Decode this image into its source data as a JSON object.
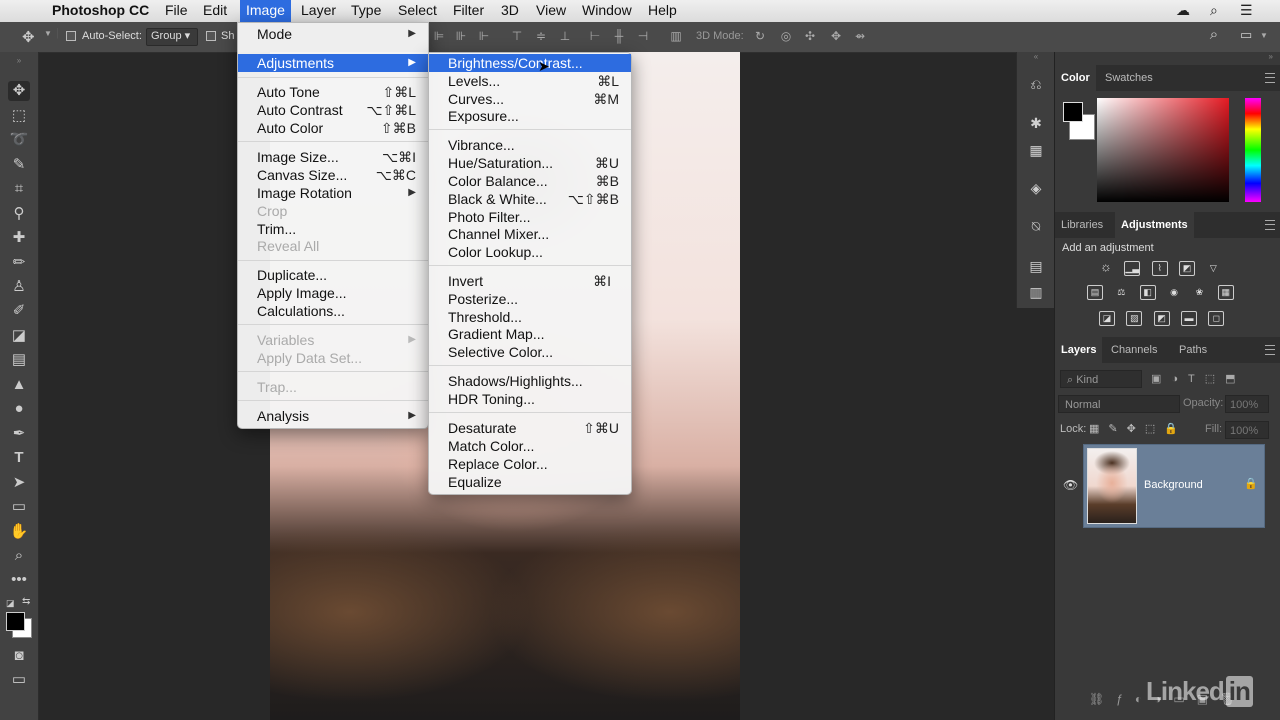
{
  "menubar": {
    "app": "Photoshop CC",
    "items": [
      "File",
      "Edit",
      "Image",
      "Layer",
      "Type",
      "Select",
      "Filter",
      "3D",
      "View",
      "Window",
      "Help"
    ],
    "active": "Image"
  },
  "options_bar": {
    "auto_select_label": "Auto-Select:",
    "auto_select_value": "Group",
    "show_label_partial": "Sh",
    "mode_3d_label": "3D Mode:"
  },
  "image_menu": {
    "items": [
      {
        "label": "Mode",
        "shortcut": "",
        "submenu": true,
        "disabled": false
      },
      {
        "label": "Adjustments",
        "shortcut": "",
        "submenu": true,
        "disabled": false,
        "highlighted": true
      },
      {
        "label": "Auto Tone",
        "shortcut": "⇧⌘L"
      },
      {
        "label": "Auto Contrast",
        "shortcut": "⌥⇧⌘L"
      },
      {
        "label": "Auto Color",
        "shortcut": "⇧⌘B"
      },
      {
        "label": "Image Size...",
        "shortcut": "⌥⌘I"
      },
      {
        "label": "Canvas Size...",
        "shortcut": "⌥⌘C"
      },
      {
        "label": "Image Rotation",
        "submenu": true
      },
      {
        "label": "Crop",
        "disabled": true
      },
      {
        "label": "Trim..."
      },
      {
        "label": "Reveal All",
        "disabled": true
      },
      {
        "label": "Duplicate..."
      },
      {
        "label": "Apply Image..."
      },
      {
        "label": "Calculations..."
      },
      {
        "label": "Variables",
        "submenu": true,
        "disabled": true
      },
      {
        "label": "Apply Data Set...",
        "disabled": true
      },
      {
        "label": "Trap...",
        "disabled": true
      },
      {
        "label": "Analysis",
        "submenu": true
      }
    ]
  },
  "adjustments_menu": {
    "items": [
      {
        "label": "Brightness/Contrast...",
        "shortcut": "",
        "highlighted": true
      },
      {
        "label": "Levels...",
        "shortcut": "⌘L"
      },
      {
        "label": "Curves...",
        "shortcut": "⌘M"
      },
      {
        "label": "Exposure...",
        "shortcut": ""
      },
      {
        "label": "Vibrance...",
        "shortcut": ""
      },
      {
        "label": "Hue/Saturation...",
        "shortcut": "⌘U"
      },
      {
        "label": "Color Balance...",
        "shortcut": "⌘B"
      },
      {
        "label": "Black & White...",
        "shortcut": "⌥⇧⌘B"
      },
      {
        "label": "Photo Filter...",
        "shortcut": ""
      },
      {
        "label": "Channel Mixer...",
        "shortcut": ""
      },
      {
        "label": "Color Lookup...",
        "shortcut": ""
      },
      {
        "label": "Invert",
        "shortcut": "⌘I"
      },
      {
        "label": "Posterize...",
        "shortcut": ""
      },
      {
        "label": "Threshold...",
        "shortcut": ""
      },
      {
        "label": "Gradient Map...",
        "shortcut": ""
      },
      {
        "label": "Selective Color...",
        "shortcut": ""
      },
      {
        "label": "Shadows/Highlights...",
        "shortcut": ""
      },
      {
        "label": "HDR Toning...",
        "shortcut": ""
      },
      {
        "label": "Desaturate",
        "shortcut": "⇧⌘U"
      },
      {
        "label": "Match Color...",
        "shortcut": ""
      },
      {
        "label": "Replace Color...",
        "shortcut": ""
      },
      {
        "label": "Equalize",
        "shortcut": ""
      }
    ]
  },
  "color_panel": {
    "tabs": [
      "Color",
      "Swatches"
    ],
    "active": "Color"
  },
  "adjustments_panel": {
    "tabs": [
      "Libraries",
      "Adjustments"
    ],
    "active": "Adjustments",
    "heading": "Add an adjustment"
  },
  "layers_panel": {
    "tabs": [
      "Layers",
      "Channels",
      "Paths"
    ],
    "active": "Layers",
    "filter_label": "Kind",
    "blend_mode": "Normal",
    "opacity_label": "Opacity:",
    "opacity_value": "100%",
    "lock_label": "Lock:",
    "fill_label": "Fill:",
    "fill_value": "100%",
    "layer_name": "Background"
  },
  "watermark": {
    "text": "Linked",
    "in": "in"
  }
}
